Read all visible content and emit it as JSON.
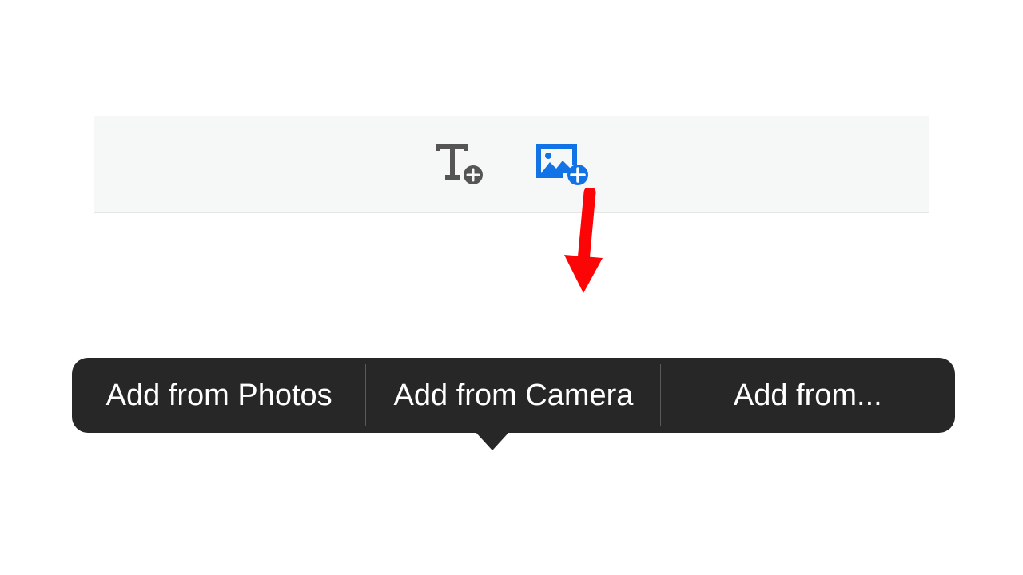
{
  "toolbar": {
    "icons": [
      {
        "name": "add-text-icon"
      },
      {
        "name": "add-image-icon"
      }
    ]
  },
  "popup": {
    "items": [
      {
        "label": "Add from Photos"
      },
      {
        "label": "Add from Camera"
      },
      {
        "label": "Add from..."
      }
    ]
  },
  "colors": {
    "accent": "#1173e6",
    "icon_gray": "#555555",
    "menu_bg": "#272727",
    "arrow": "#fb0506"
  }
}
